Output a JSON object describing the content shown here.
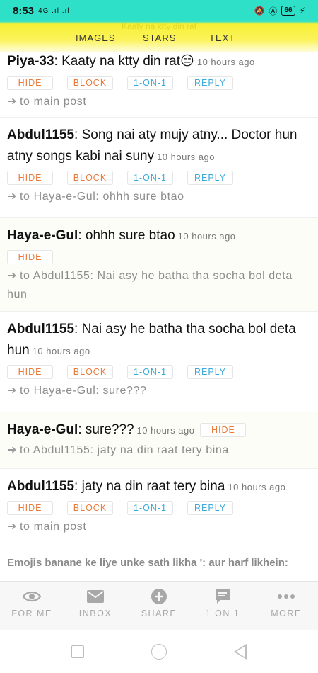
{
  "status_bar": {
    "time": "8:53",
    "signal": "4G .ıl .ıl",
    "battery": "66"
  },
  "header": {
    "ghost_text": "Kaaty na ktty din rat",
    "tabs": [
      {
        "label": "IMAGES"
      },
      {
        "label": "STARS"
      },
      {
        "label": "TEXT"
      }
    ]
  },
  "buttons": {
    "hide": "HIDE",
    "block": "BLOCK",
    "one_on_one": "1-ON-1",
    "reply": "REPLY"
  },
  "posts": [
    {
      "user": "Piya-33",
      "sep": ":",
      "text": " Kaaty na ktty din rat😑",
      "time": "10 hours ago",
      "ref": "to main post"
    },
    {
      "user": "Abdul1155",
      "sep": ":",
      "text": " Song nai aty mujy atny... Doctor hun atny songs kabi nai suny",
      "time": "10 hours ago",
      "ref": "to Haya-e-Gul: ohhh sure btao"
    },
    {
      "user": "Haya-e-Gul",
      "sep": ":",
      "text": " ohhh sure btao",
      "time": "10 hours ago",
      "ref": "to Abdul1155: Nai asy he batha tha socha bol deta hun"
    },
    {
      "user": "Abdul1155",
      "sep": ":",
      "text": " Nai asy he batha tha socha bol deta hun",
      "time": "10 hours ago",
      "ref": "to Haya-e-Gul: sure???"
    },
    {
      "user": "Haya-e-Gul",
      "sep": ":",
      "text": " sure???",
      "time": "10 hours ago",
      "ref": "to Abdul1155: jaty na din raat tery bina"
    },
    {
      "user": "Abdul1155",
      "sep": ":",
      "text": " jaty na din raat tery bina",
      "time": "10 hours ago",
      "ref": "to main post"
    }
  ],
  "ref_arrow": "➜",
  "hint": "Emojis banane ke liye unke sath likha ': aur harf likhein:",
  "bottom_nav": [
    {
      "label": "FOR ME"
    },
    {
      "label": "INBOX"
    },
    {
      "label": "SHARE"
    },
    {
      "label": "1 ON 1"
    },
    {
      "label": "MORE"
    }
  ]
}
